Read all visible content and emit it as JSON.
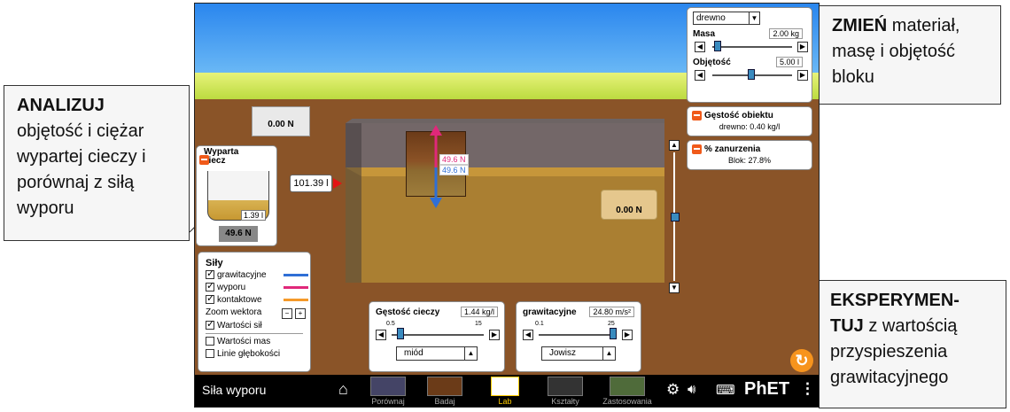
{
  "callouts": {
    "analyze_title": "ANALIZUJ",
    "analyze_text": "objętość i ciężar wypartej cieczy i porównaj z siłą wyporu",
    "change_title": "ZMIEŃ",
    "change_text": "materiał, masę i objętość bloku",
    "experiment_title_1": "EKSPERYMEN-",
    "experiment_title_2": "TUJ",
    "experiment_text": "z wartością przyspieszenia grawitacyjnego"
  },
  "material_panel": {
    "material": "drewno",
    "mass_label": "Masa",
    "mass_value": "2.00 kg",
    "volume_label": "Objętość",
    "volume_value": "5.00 l"
  },
  "density_panel": {
    "title": "Gęstość obiektu",
    "value": "drewno: 0.40 kg/l"
  },
  "submerged_panel": {
    "title": "% zanurzenia",
    "value": "Blok: 27.8%"
  },
  "scales": {
    "left": "0.00 N",
    "right": "0.00 N"
  },
  "displaced": {
    "title": "Wyparta ciecz",
    "volume": "1.39 l",
    "weight": "49.6 N"
  },
  "pool": {
    "level": "101.39 l"
  },
  "forces_labels": {
    "up": "49.6 N",
    "down": "49.6 N"
  },
  "forces_panel": {
    "title": "Siły",
    "gravity": "grawitacyjne",
    "buoyancy": "wyporu",
    "contact": "kontaktowe",
    "zoom": "Zoom wektora",
    "force_values": "Wartości sił",
    "mass_values": "Wartości mas",
    "depth_lines": "Linie głębokości",
    "colors": {
      "gravity": "#2f6fd6",
      "buoyancy": "#e0287a",
      "contact": "#f59a2a"
    }
  },
  "fluid_panel": {
    "title": "Gęstość cieczy",
    "value": "1.44 kg/l",
    "min": "0.5",
    "max": "15",
    "fluid": "miód",
    "fraction": 0.06
  },
  "gravity_panel": {
    "title": "grawitacyjne",
    "value": "24.80 m/s²",
    "min": "0.1",
    "max": "25",
    "planet": "Jowisz",
    "fraction": 0.99
  },
  "navbar": {
    "title": "Siła wyporu",
    "tabs": [
      "Porównaj",
      "Badaj",
      "Lab",
      "Kształty",
      "Zastosowania"
    ],
    "active_tab": "Lab",
    "brand": "PhET"
  }
}
